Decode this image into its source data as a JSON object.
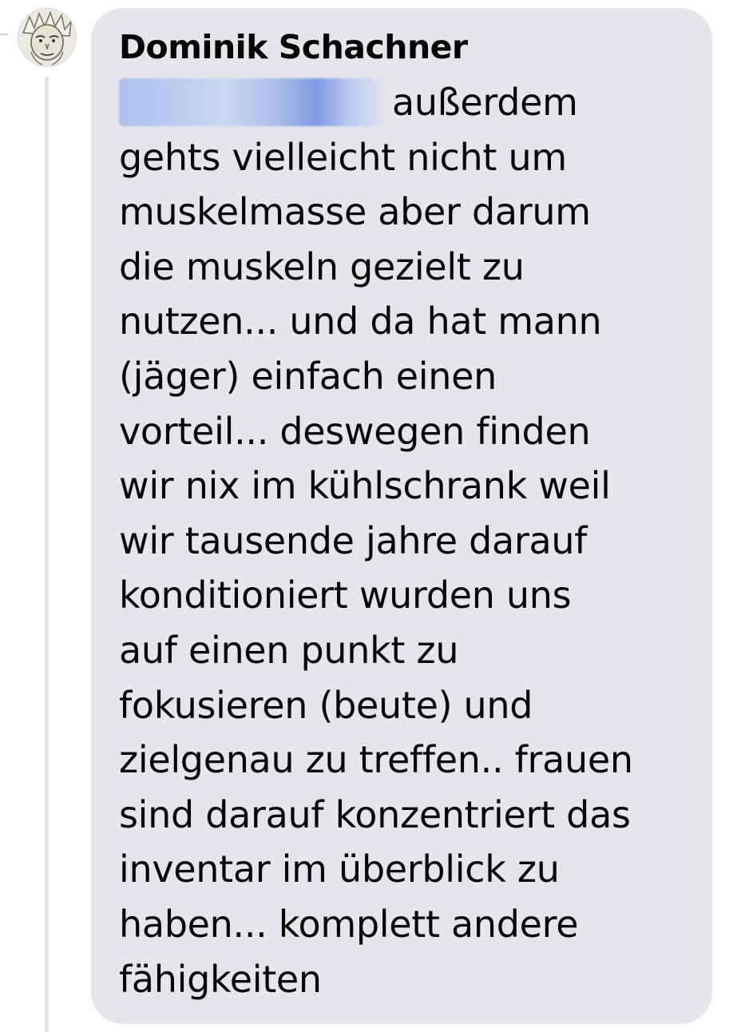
{
  "comment": {
    "author": "Dominik Schachner",
    "lines": [
      "außerdem",
      "gehts vielleicht nicht um",
      "muskelmasse aber darum",
      "die muskeln gezielt zu",
      "nutzen... und da hat mann",
      "(jäger) einfach einen",
      "vorteil... deswegen finden",
      "wir nix im kühlschrank weil",
      "wir tausende jahre darauf",
      "konditioniert wurden uns",
      "auf einen punkt zu",
      "fokusieren (beute) und",
      "zielgenau zu treffen.. frauen",
      "sind darauf konzentriert das",
      "inventar im überblick zu",
      "haben... komplett andere",
      "fähigkeiten"
    ]
  },
  "colors": {
    "bubble": "#e4e6eb",
    "text": "#050505",
    "mention_blur": "#8fa8e6",
    "thread_line": "#e3e5e9"
  },
  "icons": {
    "avatar": "cartoon-character-avatar"
  }
}
